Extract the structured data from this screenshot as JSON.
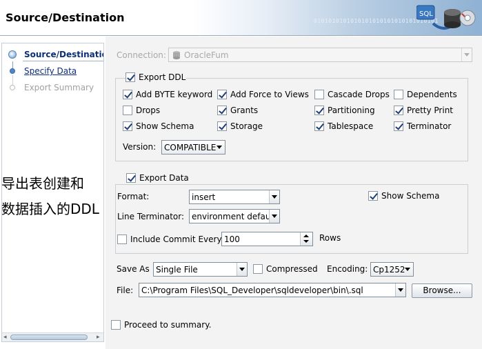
{
  "header": {
    "title": "Source/Destination",
    "binary": "0101010101010101010101010101010101"
  },
  "sidebar": {
    "steps": [
      {
        "label": "Source/Destination",
        "state": "current"
      },
      {
        "label": "Specify Data",
        "state": "link"
      },
      {
        "label": "Export Summary",
        "state": "disabled"
      }
    ]
  },
  "annotation": {
    "line1": "导出表创建和",
    "line2": "数据插入的DDL"
  },
  "connection": {
    "label": "Connection:",
    "value": "OracleFum"
  },
  "export_ddl": {
    "label": "Export DDL",
    "checked": true,
    "options": [
      {
        "label": "Add BYTE keyword",
        "checked": true
      },
      {
        "label": "Add Force to Views",
        "checked": true
      },
      {
        "label": "Cascade Drops",
        "checked": false
      },
      {
        "label": "Dependents",
        "checked": false
      },
      {
        "label": "Drops",
        "checked": false
      },
      {
        "label": "Grants",
        "checked": true
      },
      {
        "label": "Partitioning",
        "checked": true
      },
      {
        "label": "Pretty Print",
        "checked": true
      },
      {
        "label": "Show Schema",
        "checked": true
      },
      {
        "label": "Storage",
        "checked": true
      },
      {
        "label": "Tablespace",
        "checked": true
      },
      {
        "label": "Terminator",
        "checked": true
      }
    ],
    "version_label": "Version:",
    "version_value": "COMPATIBLE"
  },
  "export_data": {
    "label": "Export Data",
    "checked": true,
    "format_label": "Format:",
    "format_value": "insert",
    "show_schema_label": "Show Schema",
    "show_schema_checked": true,
    "line_terminator_label": "Line Terminator:",
    "line_terminator_value": "environment default",
    "include_commit_label": "Include Commit Every",
    "include_commit_checked": false,
    "commit_value": "100",
    "rows_label": "Rows"
  },
  "output": {
    "save_as_label": "Save As",
    "save_as_value": "Single File",
    "compressed_label": "Compressed",
    "compressed_checked": false,
    "encoding_label": "Encoding:",
    "encoding_value": "Cp1252",
    "file_label": "File:",
    "file_value": "C:\\Program Files\\SQL_Developer\\sqldeveloper\\bin\\.sql",
    "browse_label": "Browse..."
  },
  "proceed": {
    "label": "Proceed to summary.",
    "checked": false
  }
}
